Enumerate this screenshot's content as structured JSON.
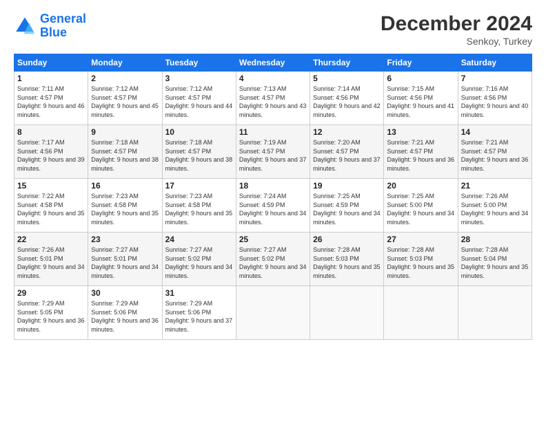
{
  "logo": {
    "line1": "General",
    "line2": "Blue"
  },
  "title": "December 2024",
  "subtitle": "Senkoy, Turkey",
  "headers": [
    "Sunday",
    "Monday",
    "Tuesday",
    "Wednesday",
    "Thursday",
    "Friday",
    "Saturday"
  ],
  "weeks": [
    [
      {
        "day": "1",
        "sunrise": "7:11 AM",
        "sunset": "4:57 PM",
        "daylight": "9 hours and 46 minutes."
      },
      {
        "day": "2",
        "sunrise": "7:12 AM",
        "sunset": "4:57 PM",
        "daylight": "9 hours and 45 minutes."
      },
      {
        "day": "3",
        "sunrise": "7:12 AM",
        "sunset": "4:57 PM",
        "daylight": "9 hours and 44 minutes."
      },
      {
        "day": "4",
        "sunrise": "7:13 AM",
        "sunset": "4:57 PM",
        "daylight": "9 hours and 43 minutes."
      },
      {
        "day": "5",
        "sunrise": "7:14 AM",
        "sunset": "4:56 PM",
        "daylight": "9 hours and 42 minutes."
      },
      {
        "day": "6",
        "sunrise": "7:15 AM",
        "sunset": "4:56 PM",
        "daylight": "9 hours and 41 minutes."
      },
      {
        "day": "7",
        "sunrise": "7:16 AM",
        "sunset": "4:56 PM",
        "daylight": "9 hours and 40 minutes."
      }
    ],
    [
      {
        "day": "8",
        "sunrise": "7:17 AM",
        "sunset": "4:56 PM",
        "daylight": "9 hours and 39 minutes."
      },
      {
        "day": "9",
        "sunrise": "7:18 AM",
        "sunset": "4:57 PM",
        "daylight": "9 hours and 38 minutes."
      },
      {
        "day": "10",
        "sunrise": "7:18 AM",
        "sunset": "4:57 PM",
        "daylight": "9 hours and 38 minutes."
      },
      {
        "day": "11",
        "sunrise": "7:19 AM",
        "sunset": "4:57 PM",
        "daylight": "9 hours and 37 minutes."
      },
      {
        "day": "12",
        "sunrise": "7:20 AM",
        "sunset": "4:57 PM",
        "daylight": "9 hours and 37 minutes."
      },
      {
        "day": "13",
        "sunrise": "7:21 AM",
        "sunset": "4:57 PM",
        "daylight": "9 hours and 36 minutes."
      },
      {
        "day": "14",
        "sunrise": "7:21 AM",
        "sunset": "4:57 PM",
        "daylight": "9 hours and 36 minutes."
      }
    ],
    [
      {
        "day": "15",
        "sunrise": "7:22 AM",
        "sunset": "4:58 PM",
        "daylight": "9 hours and 35 minutes."
      },
      {
        "day": "16",
        "sunrise": "7:23 AM",
        "sunset": "4:58 PM",
        "daylight": "9 hours and 35 minutes."
      },
      {
        "day": "17",
        "sunrise": "7:23 AM",
        "sunset": "4:58 PM",
        "daylight": "9 hours and 35 minutes."
      },
      {
        "day": "18",
        "sunrise": "7:24 AM",
        "sunset": "4:59 PM",
        "daylight": "9 hours and 34 minutes."
      },
      {
        "day": "19",
        "sunrise": "7:25 AM",
        "sunset": "4:59 PM",
        "daylight": "9 hours and 34 minutes."
      },
      {
        "day": "20",
        "sunrise": "7:25 AM",
        "sunset": "5:00 PM",
        "daylight": "9 hours and 34 minutes."
      },
      {
        "day": "21",
        "sunrise": "7:26 AM",
        "sunset": "5:00 PM",
        "daylight": "9 hours and 34 minutes."
      }
    ],
    [
      {
        "day": "22",
        "sunrise": "7:26 AM",
        "sunset": "5:01 PM",
        "daylight": "9 hours and 34 minutes."
      },
      {
        "day": "23",
        "sunrise": "7:27 AM",
        "sunset": "5:01 PM",
        "daylight": "9 hours and 34 minutes."
      },
      {
        "day": "24",
        "sunrise": "7:27 AM",
        "sunset": "5:02 PM",
        "daylight": "9 hours and 34 minutes."
      },
      {
        "day": "25",
        "sunrise": "7:27 AM",
        "sunset": "5:02 PM",
        "daylight": "9 hours and 34 minutes."
      },
      {
        "day": "26",
        "sunrise": "7:28 AM",
        "sunset": "5:03 PM",
        "daylight": "9 hours and 35 minutes."
      },
      {
        "day": "27",
        "sunrise": "7:28 AM",
        "sunset": "5:03 PM",
        "daylight": "9 hours and 35 minutes."
      },
      {
        "day": "28",
        "sunrise": "7:28 AM",
        "sunset": "5:04 PM",
        "daylight": "9 hours and 35 minutes."
      }
    ],
    [
      {
        "day": "29",
        "sunrise": "7:29 AM",
        "sunset": "5:05 PM",
        "daylight": "9 hours and 36 minutes."
      },
      {
        "day": "30",
        "sunrise": "7:29 AM",
        "sunset": "5:06 PM",
        "daylight": "9 hours and 36 minutes."
      },
      {
        "day": "31",
        "sunrise": "7:29 AM",
        "sunset": "5:06 PM",
        "daylight": "9 hours and 37 minutes."
      },
      null,
      null,
      null,
      null
    ]
  ]
}
